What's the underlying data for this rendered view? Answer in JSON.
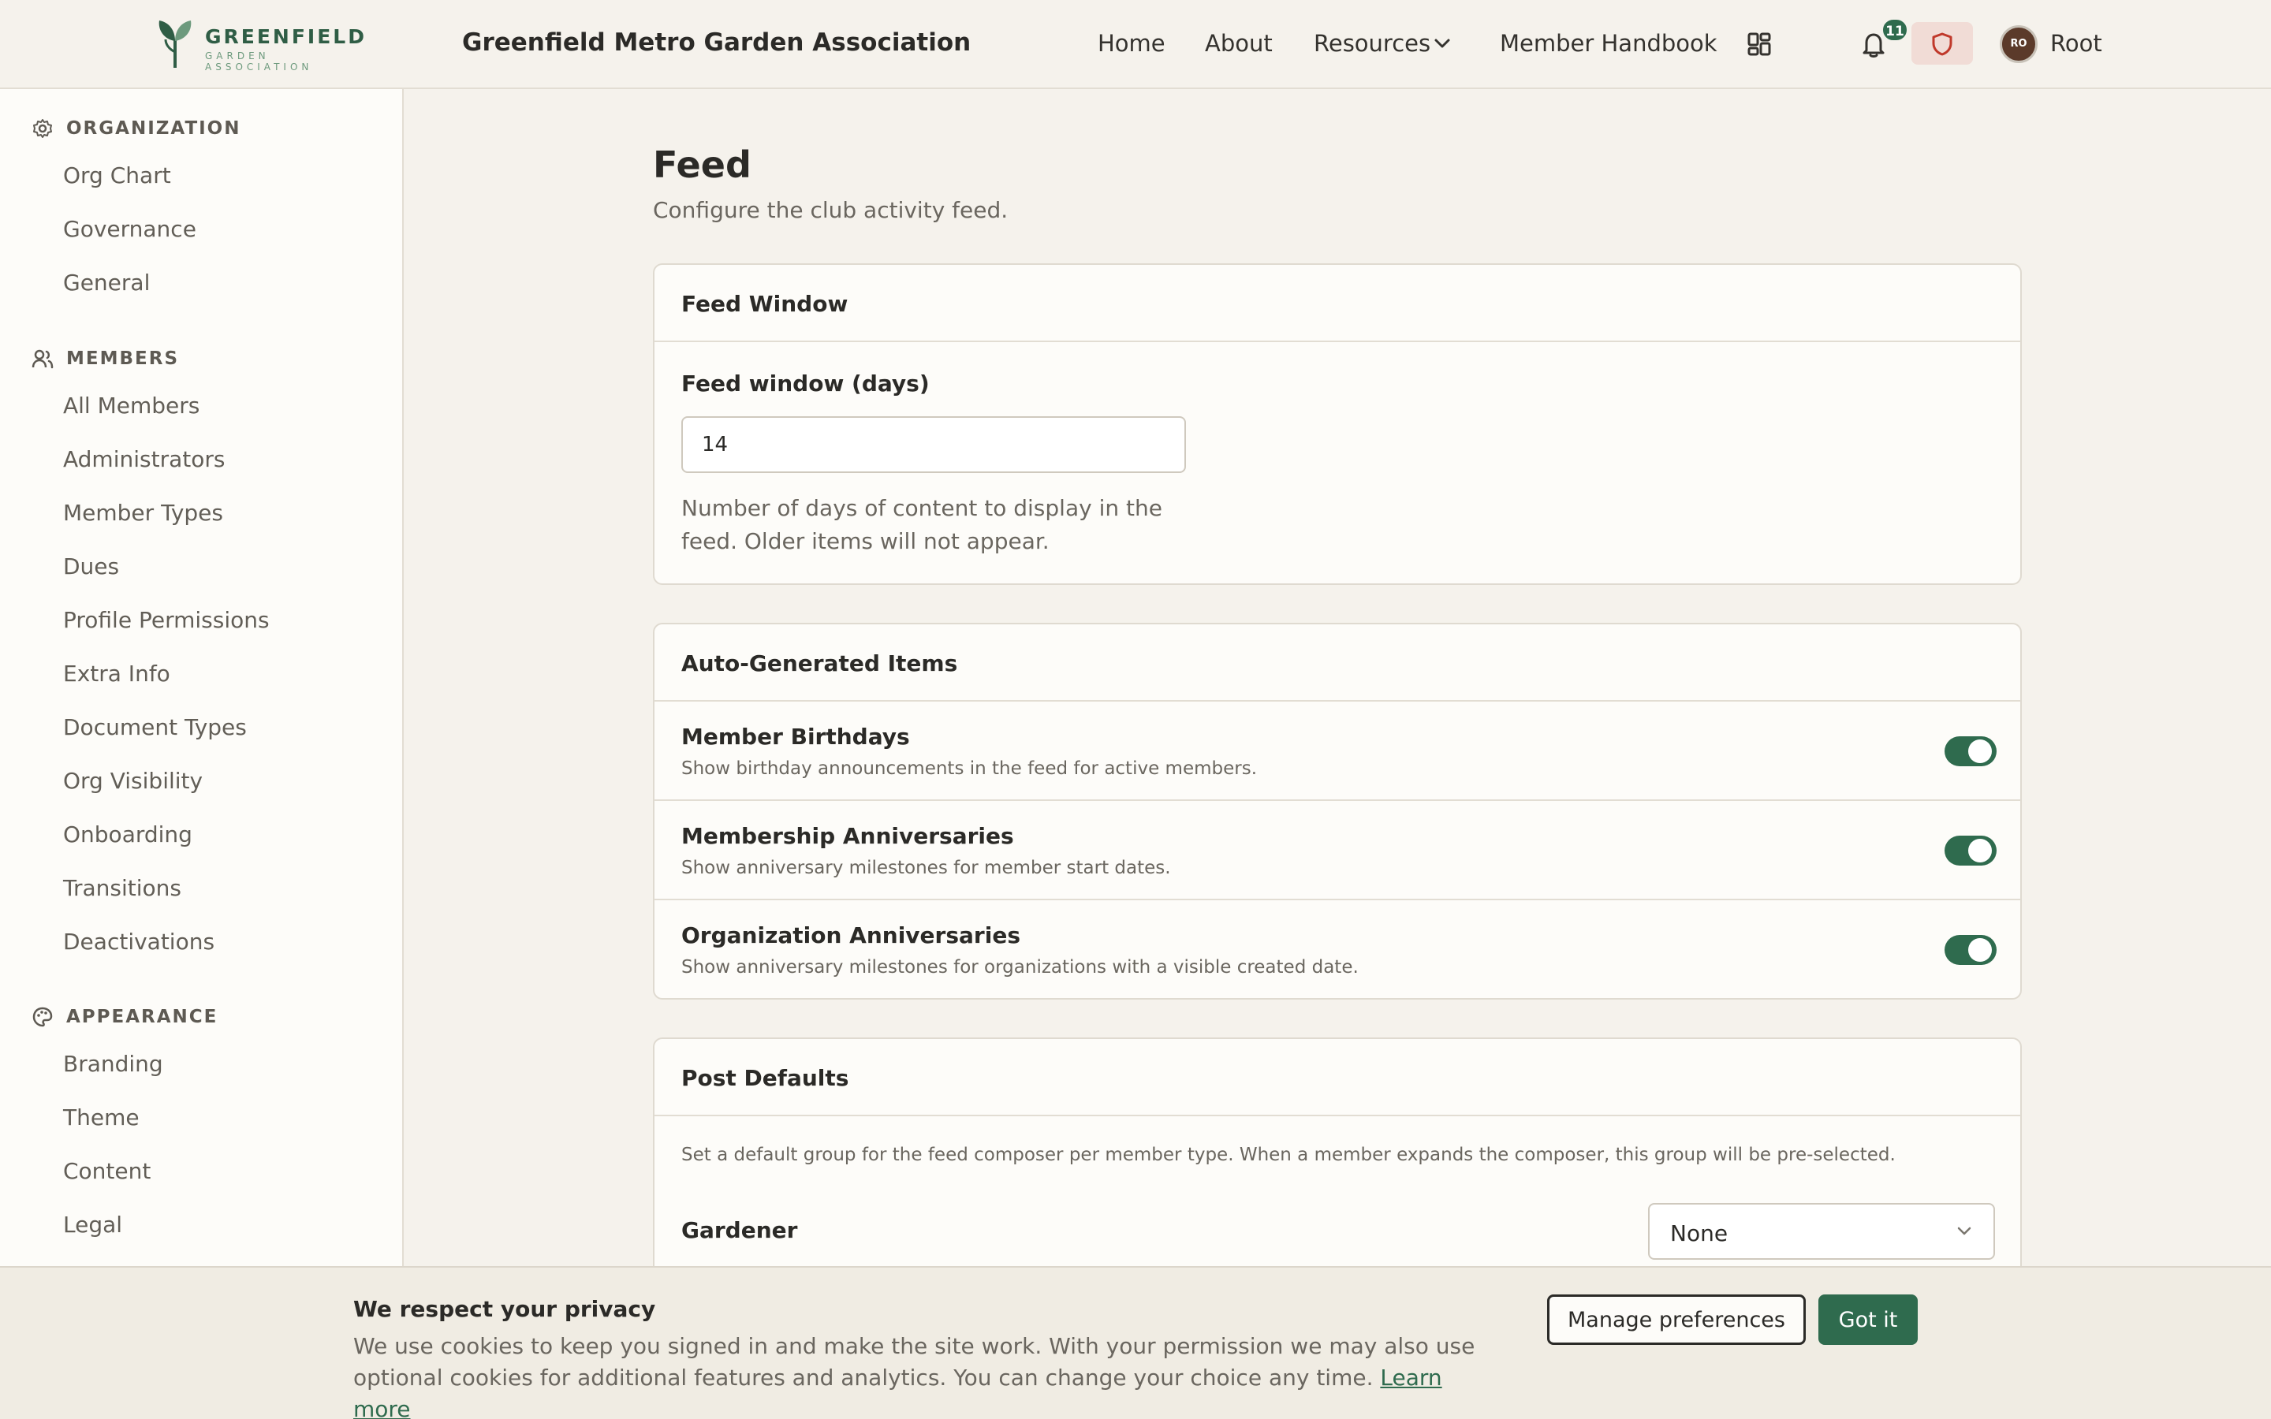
{
  "header": {
    "logo_name": "GREENFIELD",
    "logo_sub": "GARDEN ASSOCIATION",
    "site_title": "Greenfield Metro Garden Association",
    "nav": {
      "home": "Home",
      "about": "About",
      "resources": "Resources",
      "handbook": "Member Handbook"
    },
    "notification_count": "11",
    "avatar_initials": "RO",
    "user_name": "Root"
  },
  "sidebar": {
    "organization": {
      "title": "ORGANIZATION",
      "items": [
        "Org Chart",
        "Governance",
        "General"
      ]
    },
    "members": {
      "title": "MEMBERS",
      "items": [
        "All Members",
        "Administrators",
        "Member Types",
        "Dues",
        "Profile Permissions",
        "Extra Info",
        "Document Types",
        "Org Visibility",
        "Onboarding",
        "Transitions",
        "Deactivations"
      ]
    },
    "appearance": {
      "title": "APPEARANCE",
      "items": [
        "Branding",
        "Theme",
        "Content",
        "Legal"
      ]
    }
  },
  "main": {
    "title": "Feed",
    "subtitle": "Configure the club activity feed.",
    "feed_window": {
      "heading": "Feed Window",
      "label": "Feed window (days)",
      "value": "14",
      "help": "Number of days of content to display in the feed. Older items will not appear."
    },
    "auto_items": {
      "heading": "Auto-Generated Items",
      "rows": [
        {
          "title": "Member Birthdays",
          "desc": "Show birthday announcements in the feed for active members.",
          "enabled": true
        },
        {
          "title": "Membership Anniversaries",
          "desc": "Show anniversary milestones for member start dates.",
          "enabled": true
        },
        {
          "title": "Organization Anniversaries",
          "desc": "Show anniversary milestones for organizations with a visible created date.",
          "enabled": true
        }
      ]
    },
    "post_defaults": {
      "heading": "Post Defaults",
      "desc": "Set a default group for the feed composer per member type. When a member expands the composer, this group will be pre-selected.",
      "member_type": "Gardener",
      "selected": "None"
    }
  },
  "cookie": {
    "title": "We respect your privacy",
    "text": "We use cookies to keep you signed in and make the site work. With your permission we may also use optional cookies for additional features and analytics. You can change your choice any time.",
    "learn_more": "Learn more",
    "manage": "Manage preferences",
    "accept": "Got it"
  },
  "colors": {
    "accent": "#2f6b4e",
    "background": "#f5f2ec",
    "card": "#fdfcf9"
  }
}
